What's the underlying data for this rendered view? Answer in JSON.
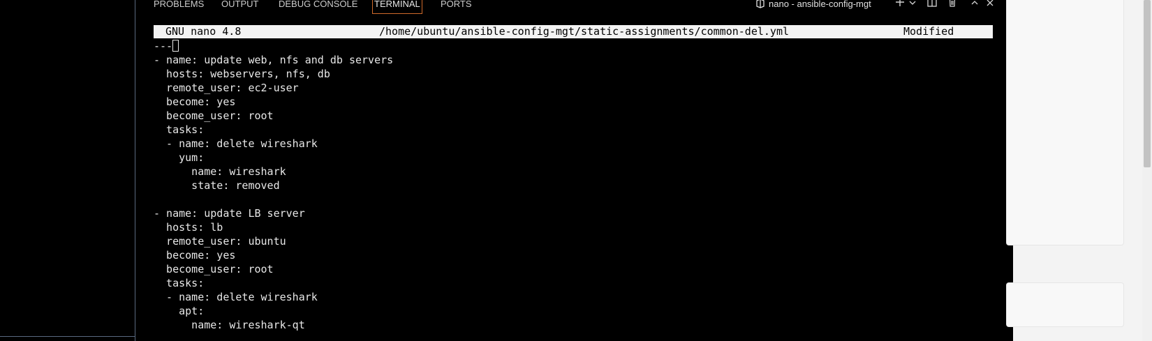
{
  "panel": {
    "tabs": [
      "PROBLEMS",
      "OUTPUT",
      "DEBUG CONSOLE",
      "TERMINAL",
      "PORTS"
    ],
    "active_tab": "TERMINAL",
    "terminal_title": "nano - ansible-config-mgt",
    "toolbar": {
      "add_icon": "plus-icon",
      "dropdown_icon": "chevron-down-icon",
      "split_icon": "split-icon",
      "trash_icon": "trash-icon",
      "maximize_icon": "chevron-up-icon",
      "close_icon": "close-icon"
    }
  },
  "nano": {
    "version": "GNU nano 4.8",
    "path": "/home/ubuntu/ansible-config-mgt/static-assignments/common-del.yml",
    "status": "Modified"
  },
  "code_lines": [
    "---",
    "- name: update web, nfs and db servers",
    "  hosts: webservers, nfs, db",
    "  remote_user: ec2-user",
    "  become: yes",
    "  become_user: root",
    "  tasks:",
    "  - name: delete wireshark",
    "    yum:",
    "      name: wireshark",
    "      state: removed",
    "",
    "- name: update LB server",
    "  hosts: lb",
    "  remote_user: ubuntu",
    "  become: yes",
    "  become_user: root",
    "  tasks:",
    "  - name: delete wireshark",
    "    apt:",
    "      name: wireshark-qt"
  ],
  "colors": {
    "terminal_bg": "#000000",
    "terminal_fg": "#e8e8e8",
    "header_bg": "#f3f3f3",
    "active_tab_border": "#d06a2a"
  }
}
